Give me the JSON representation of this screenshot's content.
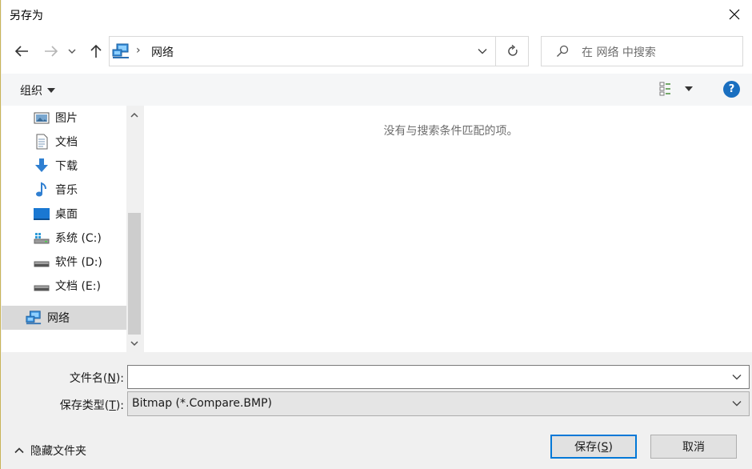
{
  "window": {
    "title": "另存为"
  },
  "address": {
    "location": "网络",
    "separator": "›"
  },
  "search": {
    "placeholder": "在 网络 中搜索"
  },
  "toolbar": {
    "organize_label": "组织",
    "help_label": "?"
  },
  "nav_pane": {
    "items": [
      {
        "label": "图片",
        "icon": "pictures-icon"
      },
      {
        "label": "文档",
        "icon": "documents-icon"
      },
      {
        "label": "下载",
        "icon": "downloads-icon"
      },
      {
        "label": "音乐",
        "icon": "music-icon"
      },
      {
        "label": "桌面",
        "icon": "desktop-icon"
      },
      {
        "label": "系统 (C:)",
        "icon": "system-drive-icon"
      },
      {
        "label": "软件 (D:)",
        "icon": "drive-icon"
      },
      {
        "label": "文档 (E:)",
        "icon": "drive-icon"
      },
      {
        "label": "网络",
        "icon": "network-icon",
        "selected": true
      }
    ]
  },
  "content": {
    "empty_message": "没有与搜索条件匹配的项。"
  },
  "form": {
    "filename_label": "文件名(",
    "filename_key": "N",
    "filename_label_end": "):",
    "filename_value": "",
    "filetype_label": "保存类型(",
    "filetype_key": "T",
    "filetype_label_end": "):",
    "filetype_value": "Bitmap (*.Compare.BMP)"
  },
  "footer": {
    "hide_folders_label": "隐藏文件夹",
    "save_label": "保存(",
    "save_key": "S",
    "save_label_end": ")",
    "cancel_label": "取消"
  },
  "colors": {
    "accent": "#0078d7",
    "help_bg": "#1a6fc0",
    "selected_bg": "#d9d9d9"
  }
}
